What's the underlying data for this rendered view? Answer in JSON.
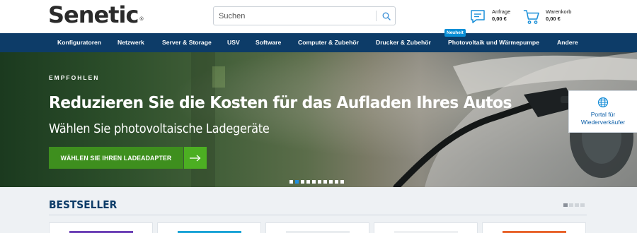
{
  "header": {
    "logo": "Senetic",
    "logo_mark": "®",
    "search": {
      "placeholder": "Suchen"
    },
    "inquiry": {
      "label": "Anfrage",
      "value": "0,00 €"
    },
    "cart": {
      "label": "Warenkorb",
      "value": "0,00 €"
    }
  },
  "nav": {
    "items": [
      {
        "label": "Konfiguratoren"
      },
      {
        "label": "Netzwerk"
      },
      {
        "label": "Server & Storage"
      },
      {
        "label": "USV"
      },
      {
        "label": "Software"
      },
      {
        "label": "Computer & Zubehör"
      },
      {
        "label": "Drucker & Zubehör"
      },
      {
        "label": "Photovoltaik und Wärmepumpe"
      },
      {
        "label": "Andere"
      }
    ],
    "new_badge": "Neuheit"
  },
  "hero": {
    "eyebrow": "EMPFOHLEN",
    "title": "Reduzieren Sie die Kosten für das Aufladen Ihres Autos",
    "subtitle": "Wählen Sie photovoltaische Ladegeräte",
    "cta": "WÄHLEN SIE IHREN LADEADAPTER",
    "slide_count": 10,
    "active_slide": 2
  },
  "portal": {
    "label_line1": "Portal für",
    "label_line2": "Wiederverkäufer"
  },
  "bestseller": {
    "title": "BESTSELLER",
    "pages": 4,
    "active_page": 1,
    "card_count": 5
  },
  "colors": {
    "nav_bg": "#0d3c68",
    "accent_blue": "#1f8fe0",
    "cta_green": "#3e8f1e",
    "cta_arrow_green": "#4caf22",
    "badge_blue": "#0a8fd6"
  },
  "icons": {
    "search": "search-icon",
    "inquiry": "chat-bubble-icon",
    "cart": "shopping-cart-icon",
    "arrow": "arrow-right-icon",
    "portal": "globe-icon"
  }
}
